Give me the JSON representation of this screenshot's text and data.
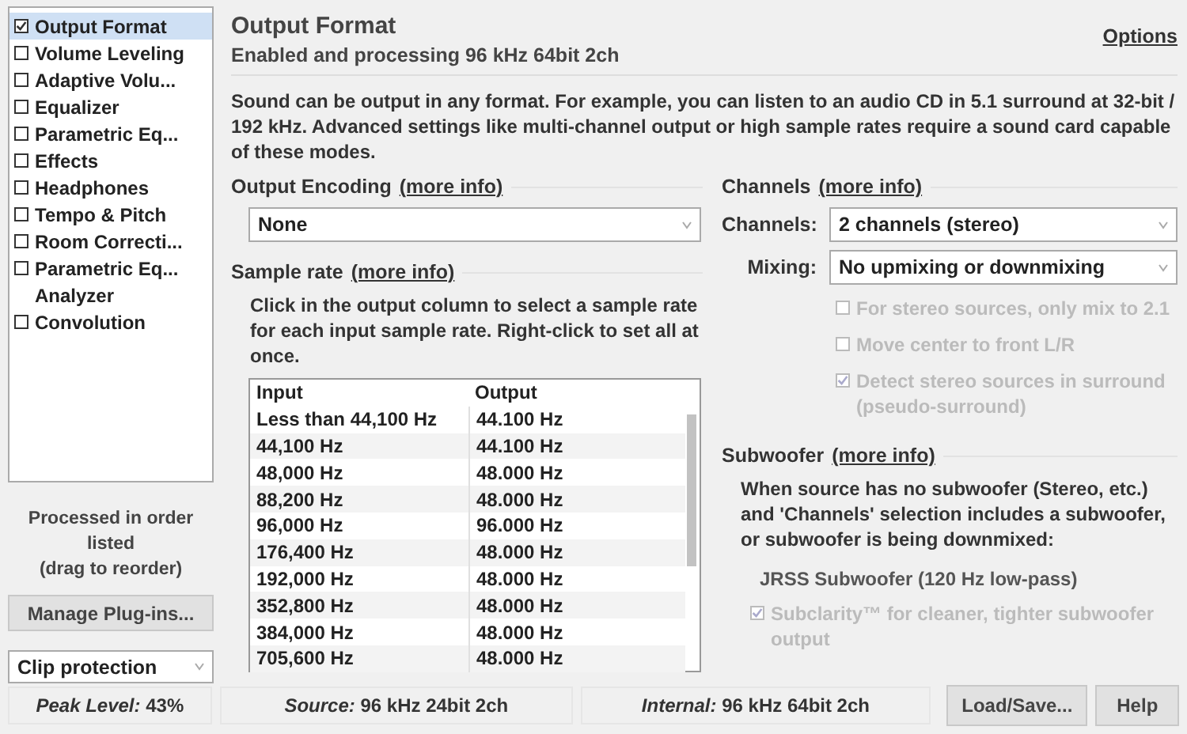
{
  "sidebar": {
    "items": [
      {
        "kind": "checkbox",
        "label": "Output Format",
        "checked": true,
        "selected": true
      },
      {
        "kind": "checkbox",
        "label": "Volume Leveling",
        "checked": false,
        "selected": false
      },
      {
        "kind": "checkbox",
        "label": "Adaptive Volu...",
        "checked": false,
        "selected": false
      },
      {
        "kind": "checkbox",
        "label": "Equalizer",
        "checked": false,
        "selected": false
      },
      {
        "kind": "checkbox",
        "label": "Parametric Eq...",
        "checked": false,
        "selected": false
      },
      {
        "kind": "checkbox",
        "label": "Effects",
        "checked": false,
        "selected": false
      },
      {
        "kind": "checkbox",
        "label": "Headphones",
        "checked": false,
        "selected": false
      },
      {
        "kind": "checkbox",
        "label": "Tempo & Pitch",
        "checked": false,
        "selected": false
      },
      {
        "kind": "checkbox",
        "label": "Room Correcti...",
        "checked": false,
        "selected": false
      },
      {
        "kind": "checkbox",
        "label": "Parametric Eq...",
        "checked": false,
        "selected": false
      },
      {
        "kind": "plain",
        "label": "Analyzer",
        "selected": false
      },
      {
        "kind": "checkbox",
        "label": "Convolution",
        "checked": false,
        "selected": false
      }
    ],
    "note": [
      "Processed in order listed",
      "(drag to reorder)"
    ],
    "manage_button": "Manage Plug-ins...",
    "clip_dropdown": {
      "value": "Clip protection"
    }
  },
  "header": {
    "title": "Output Format",
    "subtitle": "Enabled and processing 96 kHz 64bit 2ch",
    "options_link": "Options"
  },
  "description": "Sound can be output in any format.  For example, you can listen to an audio CD in 5.1 surround at 32-bit / 192 kHz.  Advanced settings like multi-channel output or high sample rates require a sound card capable of these modes.",
  "output_encoding": {
    "title": "Output Encoding",
    "link": "(more info)",
    "dropdown": {
      "value": "None"
    }
  },
  "sample_rate": {
    "title": "Sample rate",
    "link": "(more info)",
    "text": "Click in the output column to select a sample rate for each input sample rate.  Right-click to set all at once.",
    "table": {
      "columns": [
        "Input",
        "Output"
      ],
      "rows": [
        [
          "Less than 44,100 Hz",
          "44.100 Hz"
        ],
        [
          "44,100 Hz",
          "44.100 Hz"
        ],
        [
          "48,000 Hz",
          "48.000 Hz"
        ],
        [
          "88,200 Hz",
          "48.000 Hz"
        ],
        [
          "96,000 Hz",
          "96.000 Hz"
        ],
        [
          "176,400 Hz",
          "48.000 Hz"
        ],
        [
          "192,000 Hz",
          "48.000 Hz"
        ],
        [
          "352,800 Hz",
          "48.000 Hz"
        ],
        [
          "384,000 Hz",
          "48.000 Hz"
        ],
        [
          "705,600 Hz",
          "48.000 Hz"
        ]
      ]
    }
  },
  "channels": {
    "title": "Channels",
    "link": "(more info)",
    "fields": [
      {
        "label": "Channels:",
        "value": "2 channels (stereo)"
      },
      {
        "label": "Mixing:",
        "value": "No upmixing or downmixing"
      }
    ],
    "options": [
      {
        "label": "For stereo sources, only mix to 2.1",
        "checked": false,
        "disabled": true
      },
      {
        "label": "Move center to front L/R",
        "checked": false,
        "disabled": true
      },
      {
        "label": "Detect stereo sources in surround (pseudo-surround)",
        "checked": true,
        "disabled": true
      }
    ]
  },
  "subwoofer": {
    "title": "Subwoofer",
    "link": "(more info)",
    "text": "When source has no subwoofer (Stereo, etc.) and 'Channels' selection includes a subwoofer, or subwoofer is being downmixed:",
    "mode": "JRSS Subwoofer (120 Hz low-pass)",
    "options": [
      {
        "label": "Subclarity™ for cleaner, tighter subwoofer output",
        "checked": true,
        "disabled": true
      }
    ]
  },
  "status_bar": {
    "items": [
      {
        "label": "Peak Level:",
        "value": "43%"
      },
      {
        "label": "Source:",
        "value": "96 kHz 24bit 2ch"
      },
      {
        "label": "Internal:",
        "value": "96 kHz 64bit 2ch"
      }
    ],
    "buttons": [
      "Load/Save...",
      "Help"
    ]
  }
}
